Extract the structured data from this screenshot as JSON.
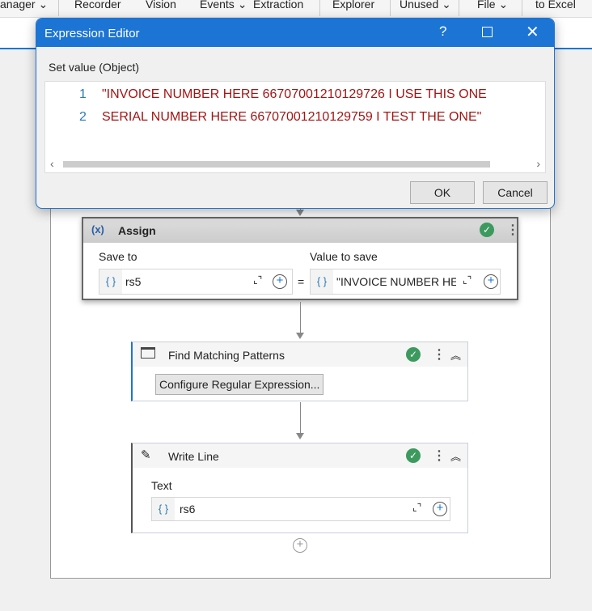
{
  "toolbar": {
    "items": [
      "anager",
      "Recorder",
      "Vision",
      "Events",
      "Extraction",
      "Explorer",
      "Unused",
      "File",
      "to Excel"
    ],
    "chev": "⌄"
  },
  "dialog": {
    "title": "Expression Editor",
    "help": "?",
    "label": "Set value (Object)",
    "lines": [
      {
        "n": "1",
        "text": "\"INVOICE NUMBER HERE 66707001210129726 I USE THIS ONE"
      },
      {
        "n": "2",
        "text": "SERIAL NUMBER HERE 66707001210129759 I TEST THE ONE\""
      }
    ],
    "ok": "OK",
    "cancel": "Cancel"
  },
  "assign": {
    "icon": "(x)",
    "title": "Assign",
    "save_to_label": "Save to",
    "save_to_value": "rs5",
    "eq": "=",
    "value_label": "Value to save",
    "value": "\"INVOICE NUMBER HE"
  },
  "find": {
    "title": "Find Matching Patterns",
    "button": "Configure Regular Expression..."
  },
  "write": {
    "title": "Write Line",
    "text_label": "Text",
    "text_value": "rs6"
  },
  "brace": "{ }"
}
